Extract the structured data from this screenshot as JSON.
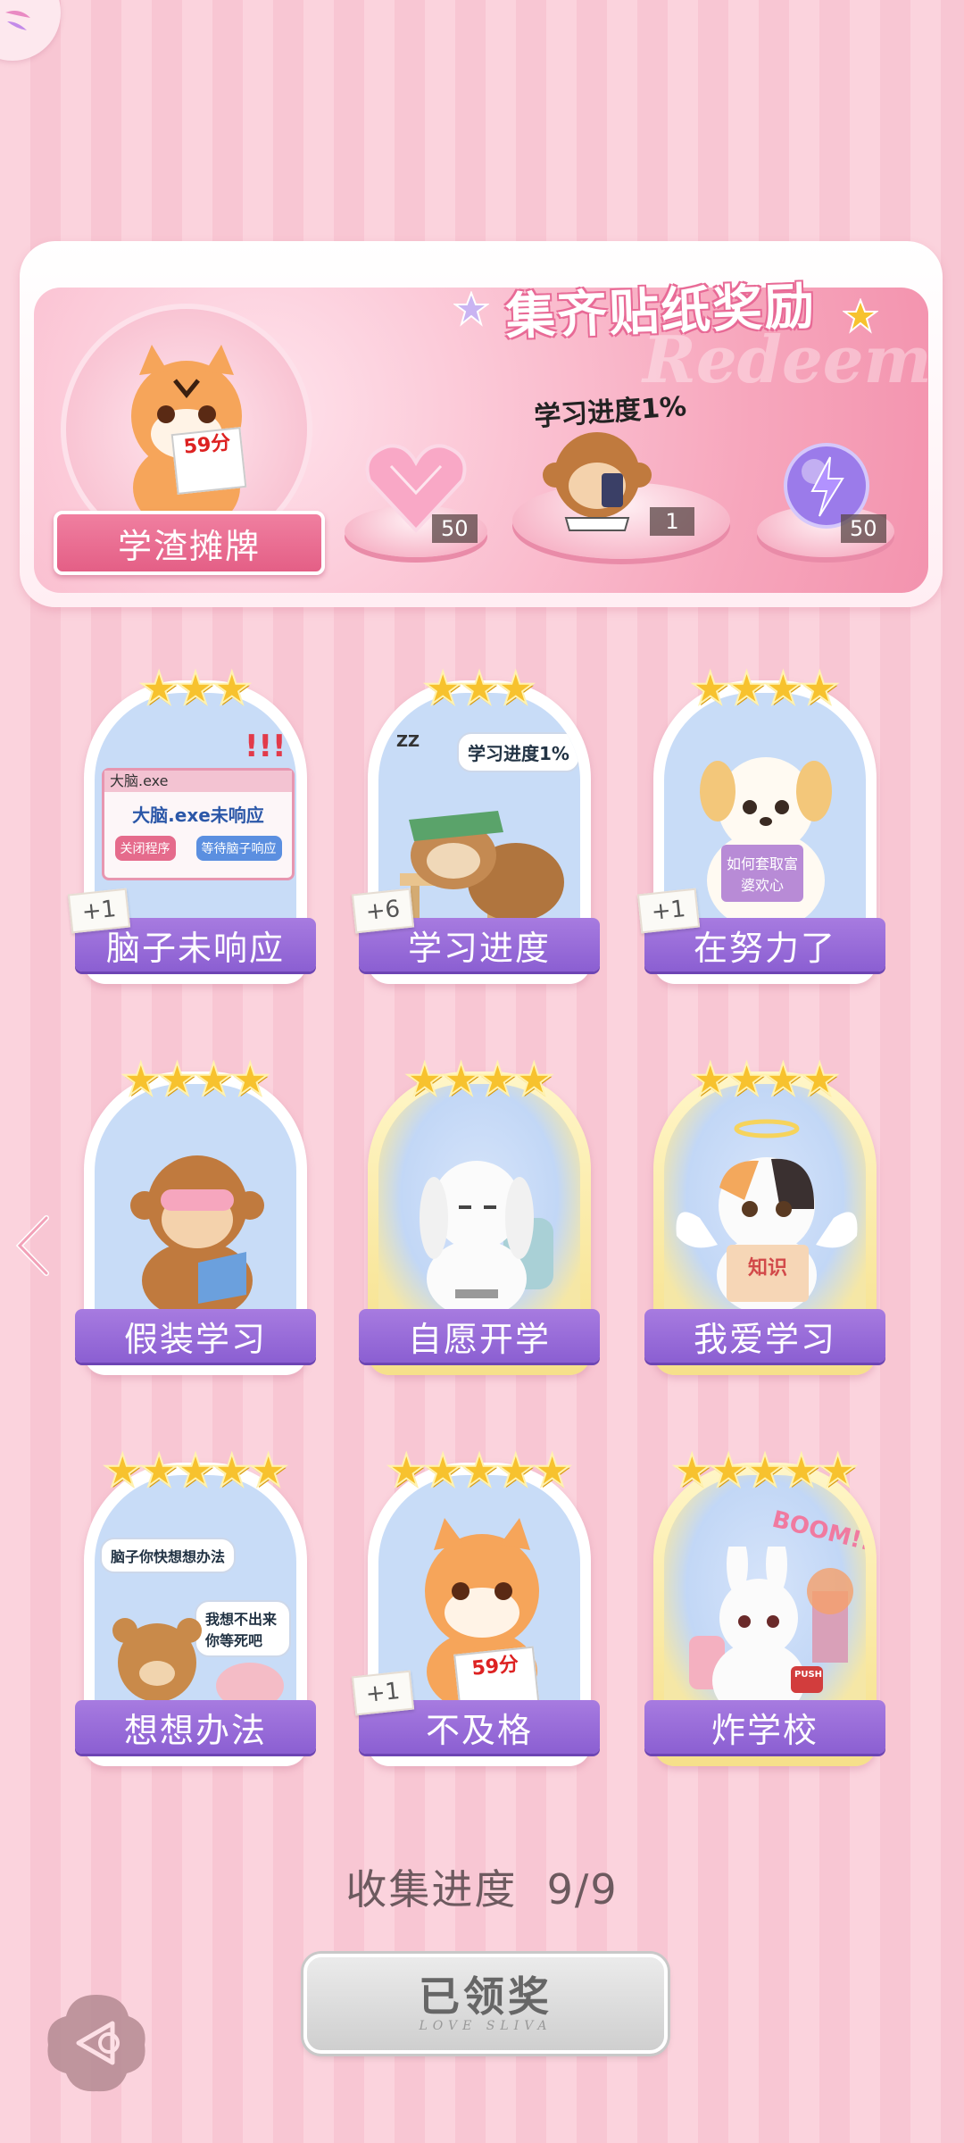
{
  "header": {
    "menu_icon": "petal-menu-icon"
  },
  "banner": {
    "title": "集齐贴纸奖励",
    "watermark": "Redeem",
    "featured_sticker_label": "学渣摊牌",
    "featured_sticker_score": "59分",
    "rewards": [
      {
        "icon": "pink-heart-gem-icon",
        "count": "50"
      },
      {
        "icon": "monkey-phone-icon",
        "label": "学习进度1%",
        "count": "1"
      },
      {
        "icon": "purple-lightning-orb-icon",
        "count": "50"
      }
    ]
  },
  "stickers": [
    {
      "label": "脑子未响应",
      "stars": 3,
      "badge": "+1",
      "rarity": "normal",
      "art": {
        "window_title": "大脑.exe",
        "message": "大脑.exe未响应",
        "btn1": "关闭程序",
        "btn2": "等待脑子响应",
        "marks": "!!!"
      }
    },
    {
      "label": "学习进度",
      "stars": 3,
      "badge": "+6",
      "rarity": "normal",
      "art": {
        "bubble": "学习进度1%",
        "zz": "ZZ"
      }
    },
    {
      "label": "在努力了",
      "stars": 4,
      "badge": "+1",
      "rarity": "normal",
      "art": {
        "book": "如何套取富婆欢心"
      }
    },
    {
      "label": "假装学习",
      "stars": 4,
      "badge": "",
      "rarity": "normal",
      "art": {}
    },
    {
      "label": "自愿开学",
      "stars": 4,
      "badge": "",
      "rarity": "gold",
      "art": {}
    },
    {
      "label": "我爱学习",
      "stars": 4,
      "badge": "",
      "rarity": "gold",
      "art": {
        "book": "知识"
      }
    },
    {
      "label": "想想办法",
      "stars": 5,
      "badge": "",
      "rarity": "normal",
      "art": {
        "bubble1": "脑子你快想想办法",
        "bubble2": "我想不出来你等死吧"
      }
    },
    {
      "label": "不及格",
      "stars": 5,
      "badge": "+1",
      "rarity": "normal",
      "art": {
        "score": "59分"
      }
    },
    {
      "label": "炸学校",
      "stars": 5,
      "badge": "",
      "rarity": "gold",
      "art": {
        "boom": "BOOM!!",
        "push": "PUSH"
      }
    }
  ],
  "progress": {
    "label": "收集进度",
    "value": "9/9"
  },
  "claim_button": {
    "label": "已领奖",
    "sub": "LOVE SLIVA"
  },
  "colors": {
    "accent_pink": "#e86a96",
    "label_purple": "#8b5fd2",
    "star_gold": "#f7c22e"
  }
}
